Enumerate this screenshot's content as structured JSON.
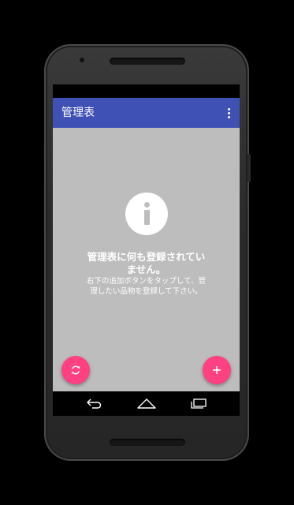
{
  "app": {
    "title": "管理表"
  },
  "empty_state": {
    "title": "管理表に何も登録されていません。",
    "message": "右下の追加ボタンをタップして、管理したい品物を登録して下さい。"
  },
  "icons": {
    "overflow": "more-vert-icon",
    "info": "info-icon",
    "refresh": "refresh-icon",
    "add": "add-icon",
    "back": "back-icon",
    "home": "home-icon",
    "recents": "recents-icon"
  },
  "colors": {
    "app_bar": "#3f51b5",
    "content_background": "#bdbdbd",
    "fab": "#ff4081"
  }
}
